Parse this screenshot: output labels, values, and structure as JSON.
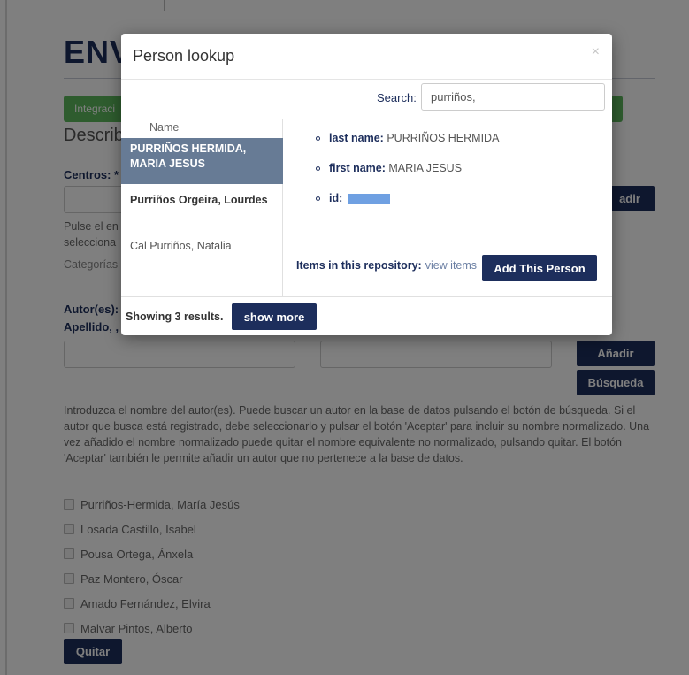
{
  "page": {
    "title": "ENV",
    "tab_label": "Integraci",
    "section_heading": "Describ",
    "centros_label": "Centros: *",
    "centros_help_1": "Pulse el en",
    "centros_help_2": "selecciona",
    "categorias_label": "Categorías",
    "centros_add_label": "adir",
    "autores_label": "Autor(es):",
    "apellido_label": "Apellido, ,",
    "add_button": "Añadir",
    "search_button": "Búsqueda",
    "instructions": "Introduzca el nombre del autor(es). Puede buscar un autor en la base de datos pulsando el botón de búsqueda. Si el autor que busca está registrado, debe seleccionarlo y pulsar el botón 'Aceptar' para incluir su nombre normalizado. Una vez añadido el nombre normalizado puede quitar el nombre equivalente no normalizado, pulsando quitar. El botón 'Aceptar' también le permite añadir un autor que no pertenece a la base de datos.",
    "authors": [
      "Purriños-Hermida, María Jesús",
      "Losada Castillo, Isabel",
      "Pousa Ortega, Ánxela",
      "Paz Montero, Óscar",
      "Amado Fernández, Elvira",
      "Malvar Pintos, Alberto"
    ],
    "remove_button": "Quitar"
  },
  "modal": {
    "title": "Person lookup",
    "close_glyph": "×",
    "search_label": "Search:",
    "search_value": "purriños,",
    "column_header": "Name",
    "results": [
      "PURRIÑOS HERMIDA, MARIA JESUS",
      "Purriños Orgeira, Lourdes",
      "Cal Purriños, Natalia"
    ],
    "details": {
      "last_name_key": "last name:",
      "last_name_value": "PURRIÑOS HERMIDA",
      "first_name_key": "first name:",
      "first_name_value": "MARIA JESUS",
      "id_key": "id:"
    },
    "repository_key": "Items in this repository:",
    "repository_link": "view items",
    "add_person_button": "Add This Person",
    "showing_text": "Showing 3 results.",
    "show_more_button": "show more"
  },
  "colors": {
    "navy": "#1d2e5c",
    "selected_row": "#677b95",
    "tab_green": "#5cb85c",
    "redaction": "#6fa0e2"
  }
}
